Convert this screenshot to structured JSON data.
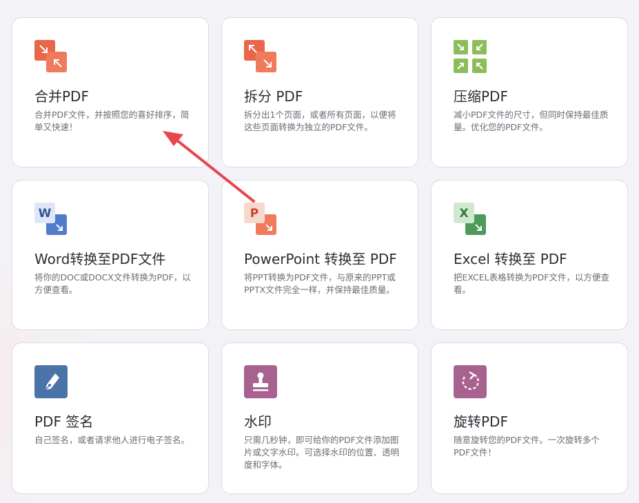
{
  "tools": [
    {
      "title": "合并PDF",
      "desc": "合并PDF文件，并按照您的喜好排序，简单又快速！",
      "icon": "merge-pdf-icon",
      "color": "#e8664a"
    },
    {
      "title": "拆分 PDF",
      "desc": "拆分出1个页面，或者所有页面，以便将这些页面转换为独立的PDF文件。",
      "icon": "split-pdf-icon",
      "color": "#e8664a"
    },
    {
      "title": "压缩PDF",
      "desc": "减小PDF文件的尺寸，但同时保持最佳质量。优化您的PDF文件。",
      "icon": "compress-pdf-icon",
      "color": "#8cbd5a"
    },
    {
      "title": "Word转换至PDF文件",
      "desc": "将你的DOC或DOCX文件转换为PDF，以方便查看。",
      "icon": "word-to-pdf-icon",
      "color": "#3f6fc0",
      "badge": "W"
    },
    {
      "title": "PowerPoint 转换至 PDF",
      "desc": "将PPT转换为PDF文件，与原来的PPT或PPTX文件完全一样，并保持最佳质量。",
      "icon": "powerpoint-to-pdf-icon",
      "color": "#e8664a",
      "badge": "P"
    },
    {
      "title": "Excel 转换至 PDF",
      "desc": "把EXCEL表格转换为PDF文件，以方便查看。",
      "icon": "excel-to-pdf-icon",
      "color": "#3f8f4a",
      "badge": "X"
    },
    {
      "title": "PDF 签名",
      "desc": "自己签名，或者请求他人进行电子签名。",
      "icon": "pen-sign-icon",
      "color": "#4a73a8"
    },
    {
      "title": "水印",
      "desc": "只需几秒钟，即可给你的PDF文件添加图片或文字水印。可选择水印的位置、透明度和字体。",
      "icon": "stamp-watermark-icon",
      "color": "#a8628f"
    },
    {
      "title": "旋转PDF",
      "desc": "随意旋转您的PDF文件。一次旋转多个PDF文件！",
      "icon": "rotate-icon",
      "color": "#a8628f"
    }
  ],
  "annotation_arrow_color": "#e8464f"
}
